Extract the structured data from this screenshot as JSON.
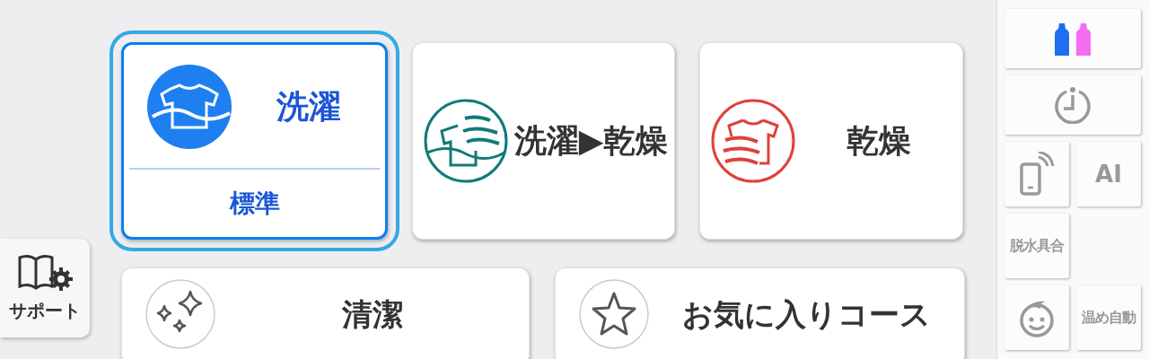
{
  "support": {
    "label": "サポート"
  },
  "courses": [
    {
      "kind": "wash",
      "label": "洗濯",
      "sublabel": "標準",
      "selected": true
    },
    {
      "kind": "wash_dry",
      "label": "洗濯▶乾燥",
      "selected": false
    },
    {
      "kind": "dry",
      "label": "乾燥",
      "selected": false
    },
    {
      "kind": "clean",
      "label": "清潔",
      "selected": false
    },
    {
      "kind": "favorite",
      "label": "お気に入りコース",
      "selected": false
    }
  ],
  "side_buttons": [
    {
      "kind": "detergent"
    },
    {
      "kind": "timer"
    },
    {
      "kind": "remote"
    },
    {
      "kind": "text",
      "label": "AI"
    },
    {
      "kind": "text",
      "label": "脱水具合"
    },
    {
      "kind": "child"
    },
    {
      "kind": "text",
      "label": "温め自動"
    }
  ]
}
